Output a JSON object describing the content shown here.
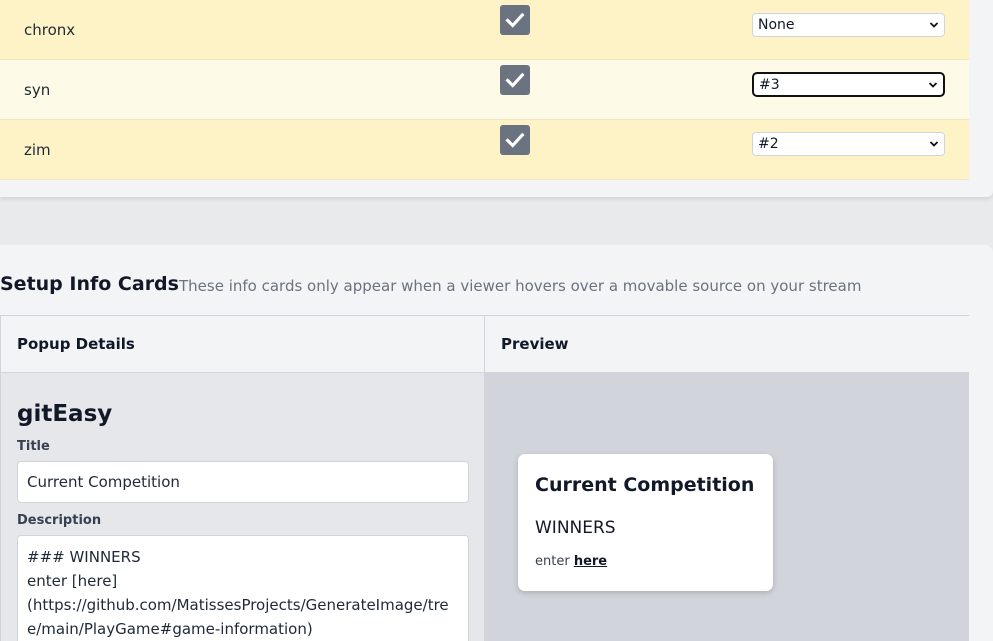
{
  "sources": {
    "rows": [
      {
        "name": "chronx",
        "enabled": true,
        "position": "None"
      },
      {
        "name": "syn",
        "enabled": true,
        "position": "#3"
      },
      {
        "name": "zim",
        "enabled": true,
        "position": "#2"
      }
    ]
  },
  "setup": {
    "heading": "Setup Info Cards",
    "subheading": "These info cards only appear when a viewer hovers over a movable source on your stream",
    "columns": {
      "details": "Popup Details",
      "preview": "Preview"
    },
    "details": {
      "source_name": "gitEasy",
      "title_label": "Title",
      "title_value": "Current Competition",
      "description_label": "Description",
      "description_value": "### WINNERS\nenter [here]\n(https://github.com/MatissesProjects/GenerateImage/tree/main/PlayGame#game-information)"
    },
    "preview": {
      "title": "Current Competition",
      "heading": "WINNERS",
      "body_prefix": "enter ",
      "body_link": "here"
    }
  },
  "colors": {
    "row_odd": "#fef3c7",
    "row_even": "#fefae8",
    "checkbox": "#6b7280"
  }
}
